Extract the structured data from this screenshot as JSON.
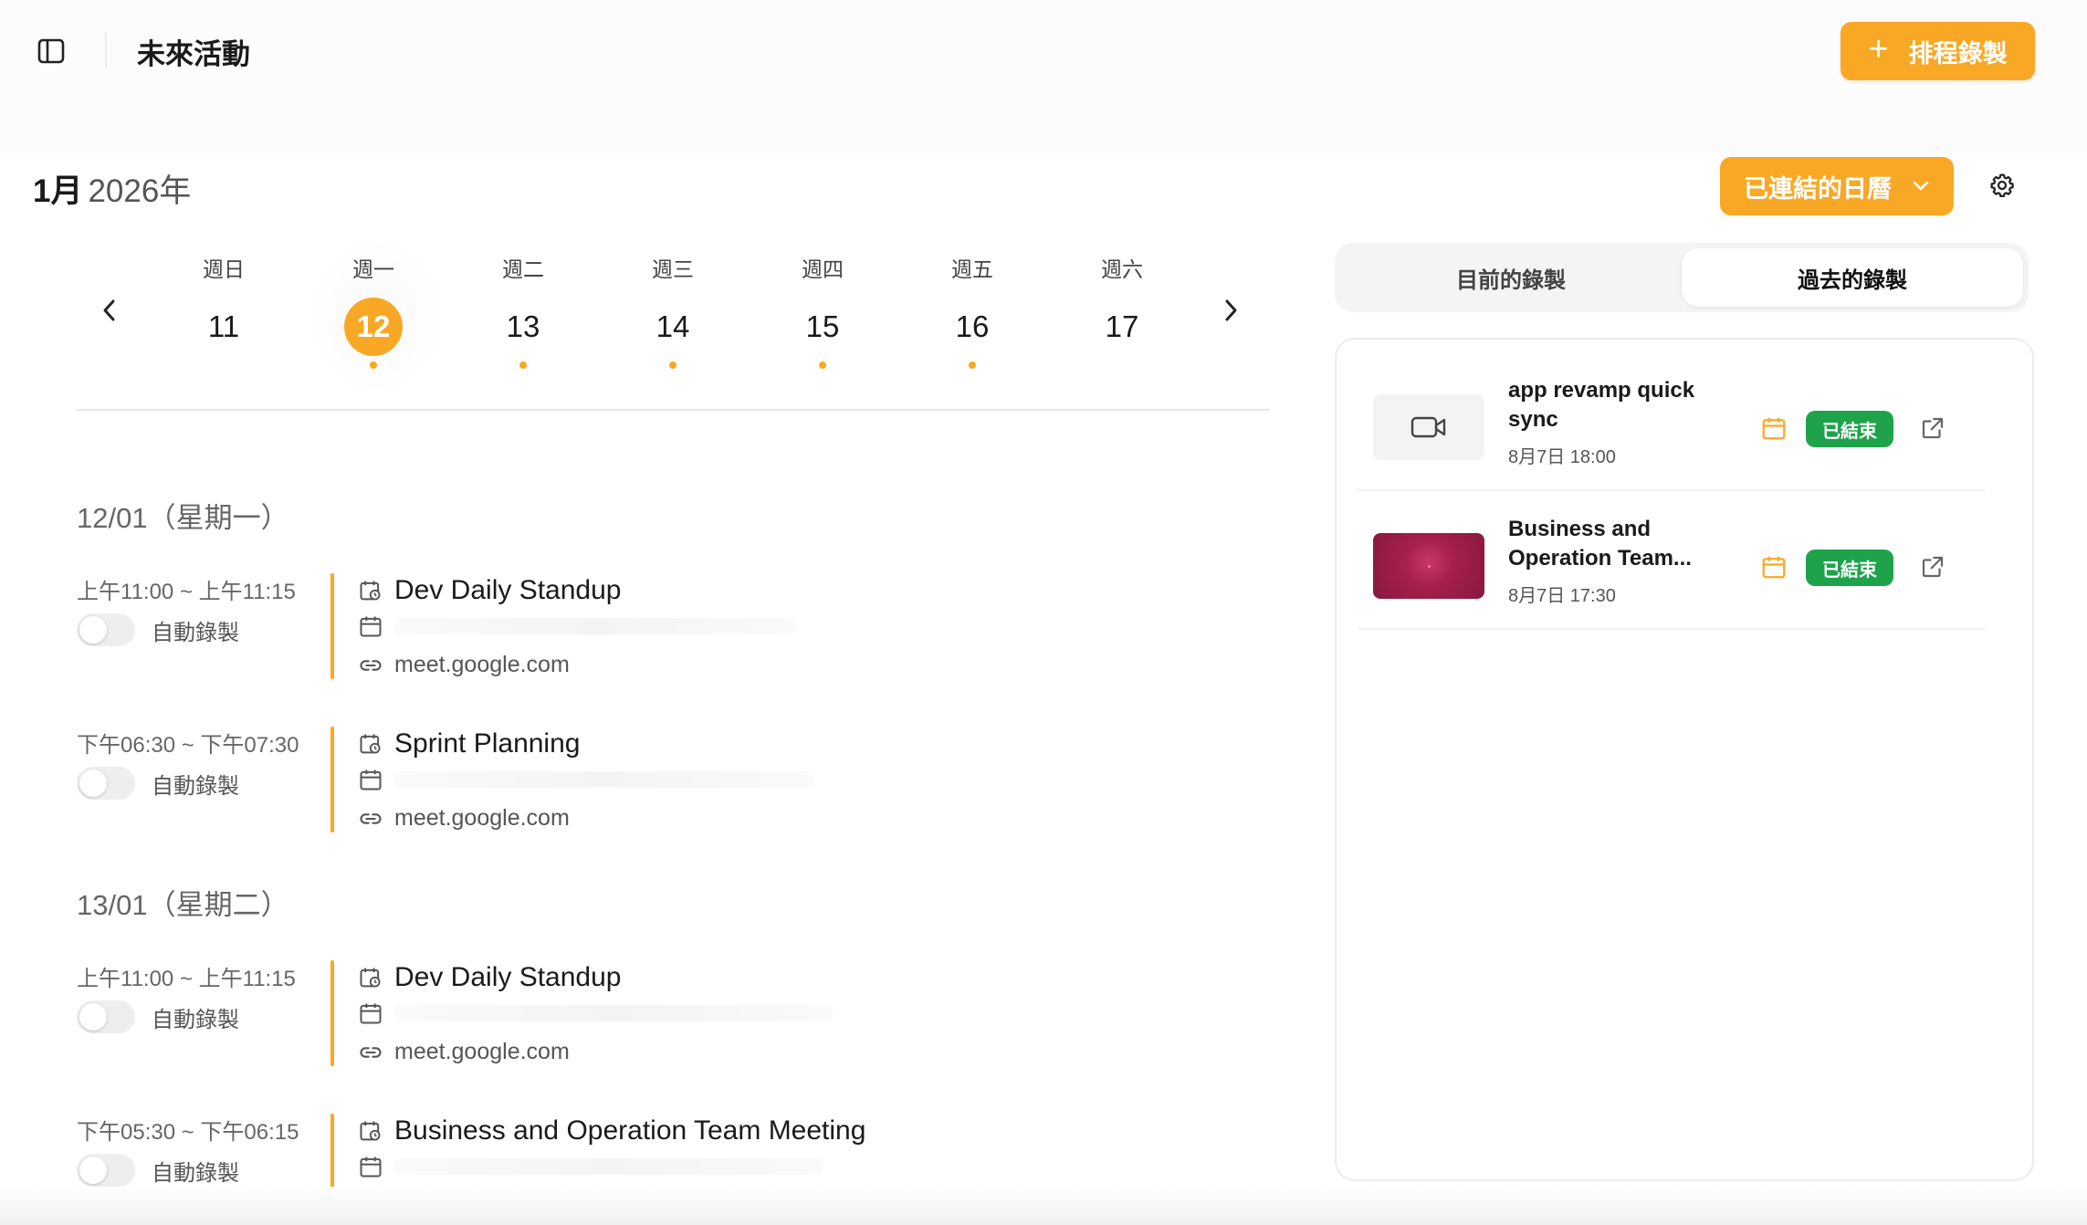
{
  "header": {
    "title": "未來活動",
    "schedule_button_label": "排程錄製"
  },
  "month": {
    "month_label": "1月",
    "year_label": "2026年"
  },
  "calendar_button_label": "已連結的日曆",
  "week": {
    "days": [
      {
        "dow": "週日",
        "num": "11",
        "dot": false,
        "active": false
      },
      {
        "dow": "週一",
        "num": "12",
        "dot": true,
        "active": true
      },
      {
        "dow": "週二",
        "num": "13",
        "dot": true,
        "active": false
      },
      {
        "dow": "週三",
        "num": "14",
        "dot": true,
        "active": false
      },
      {
        "dow": "週四",
        "num": "15",
        "dot": true,
        "active": false
      },
      {
        "dow": "週五",
        "num": "16",
        "dot": true,
        "active": false
      },
      {
        "dow": "週六",
        "num": "17",
        "dot": false,
        "active": false
      }
    ]
  },
  "events": {
    "groups": [
      {
        "heading": "12/01（星期一）",
        "items": [
          {
            "time": "上午11:00 ~ 上午11:15",
            "auto_label": "自動錄製",
            "title": "Dev Daily Standup",
            "link": "meet.google.com"
          },
          {
            "time": "下午06:30 ~ 下午07:30",
            "auto_label": "自動錄製",
            "title": "Sprint Planning",
            "link": "meet.google.com"
          }
        ]
      },
      {
        "heading": "13/01（星期二）",
        "items": [
          {
            "time": "上午11:00 ~ 上午11:15",
            "auto_label": "自動錄製",
            "title": "Dev Daily Standup",
            "link": "meet.google.com"
          },
          {
            "time": "下午05:30 ~ 下午06:15",
            "auto_label": "自動錄製",
            "title": "Business and Operation Team Meeting",
            "link": ""
          }
        ]
      }
    ]
  },
  "tabs": {
    "current": "目前的錄製",
    "past": "過去的錄製"
  },
  "recordings": [
    {
      "title": "app revamp quick sync",
      "date": "8月7日 18:00",
      "status": "已結束",
      "thumb": "camera-icon"
    },
    {
      "title": "Business and Operation Team...",
      "date": "8月7日 17:30",
      "status": "已結束",
      "thumb": "video-thumbnail"
    }
  ],
  "colors": {
    "accent": "#f9a825",
    "ended": "#1ea34b"
  }
}
